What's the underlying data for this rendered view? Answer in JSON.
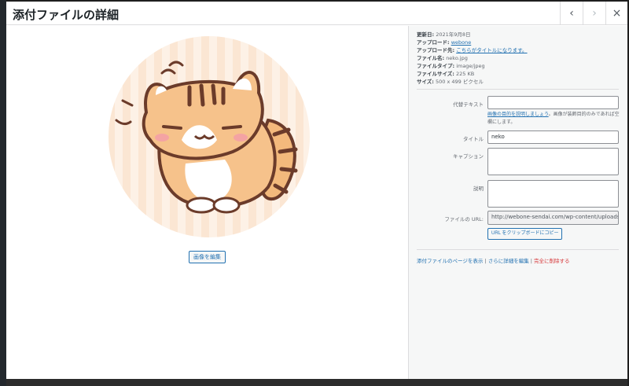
{
  "modal": {
    "title": "添付ファイルの詳細"
  },
  "header": {
    "prev_icon": "‹",
    "next_icon": "›",
    "close_icon": "×"
  },
  "media": {
    "edit_image_label": "画像を編集"
  },
  "details": {
    "uploaded_on_label": "更新日:",
    "uploaded_on": "2021年9月8日",
    "uploaded_by_label": "アップロード:",
    "uploaded_by": "webone",
    "uploaded_to_label": "アップロード先:",
    "uploaded_to": "こちらがタイトルになります。",
    "file_name_label": "ファイル名:",
    "file_name": "neko.jpg",
    "file_type_label": "ファイルタイプ:",
    "file_type": "image/jpeg",
    "file_size_label": "ファイルサイズ:",
    "file_size": "225 KB",
    "dimensions_label": "サイズ:",
    "dimensions": "500 x 499 ピクセル"
  },
  "fields": {
    "alt_label": "代替テキスト",
    "alt_value": "",
    "alt_help_link": "画像の目的を説明しましょう",
    "alt_help_text": "。画像が装飾目的のみであれば空欄にします。",
    "title_label": "タイトル",
    "title_value": "neko",
    "caption_label": "キャプション",
    "caption_value": "",
    "description_label": "説明",
    "description_value": "",
    "url_label": "ファイルの URL:",
    "url_value": "http://webone-sendai.com/wp-content/uploads",
    "copy_url_label": "URL をクリップボードにコピー"
  },
  "actions": {
    "view_page": "添付ファイルのページを表示",
    "sep1": " | ",
    "edit_more": "さらに詳細を編集",
    "sep2": " | ",
    "delete": "完全に削除する"
  },
  "colors": {
    "link": "#2271b1",
    "delete": "#d63638",
    "sidebar_bg": "#f6f7f7"
  }
}
